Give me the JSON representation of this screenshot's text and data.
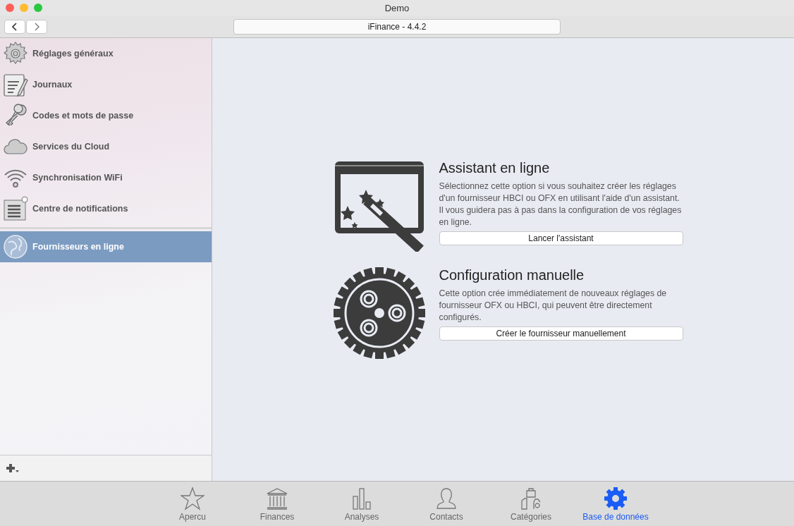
{
  "window": {
    "title": "Demo"
  },
  "toolbar": {
    "title_field": "iFinance - 4.4.2"
  },
  "sidebar": {
    "groups": [
      {
        "items": [
          {
            "label": "Réglages généraux",
            "kind": "gear",
            "selected": false
          },
          {
            "label": "Journaux",
            "kind": "notepad",
            "selected": false
          },
          {
            "label": "Codes et mots de passe",
            "kind": "keys",
            "selected": false
          },
          {
            "label": "Services du Cloud",
            "kind": "cloud",
            "selected": false
          },
          {
            "label": "Synchronisation WiFi",
            "kind": "wifi",
            "selected": false
          },
          {
            "label": "Centre de notifications",
            "kind": "notifications",
            "selected": false
          }
        ]
      },
      {
        "items": [
          {
            "label": "Fournisseurs en ligne",
            "kind": "globe",
            "selected": true
          }
        ]
      }
    ]
  },
  "options": [
    {
      "kind": "wizard",
      "title": "Assistant en ligne",
      "description": "Sélectionnez cette option si vous souhaitez créer les réglages d'un fournisseur HBCI ou OFX en utilisant l'aide d'un assistant. Il vous guidera pas à pas dans la configuration de vos réglages en ligne.",
      "button": "Lancer l'assistant"
    },
    {
      "kind": "gear",
      "title": "Configuration manuelle",
      "description": "Cette option crée immédiatement de nouveaux réglages de fournisseur OFX ou HBCI, qui peuvent être directement configurés.",
      "button": "Créer le fournisseur manuellement"
    }
  ],
  "tabs": [
    {
      "label": "Apercu",
      "kind": "star",
      "selected": false
    },
    {
      "label": "Finances",
      "kind": "bank",
      "selected": false
    },
    {
      "label": "Analyses",
      "kind": "bars",
      "selected": false
    },
    {
      "label": "Contacts",
      "kind": "person",
      "selected": false
    },
    {
      "label": "Catégories",
      "kind": "categories",
      "selected": false
    },
    {
      "label": "Base de données",
      "kind": "gear",
      "selected": true
    }
  ]
}
